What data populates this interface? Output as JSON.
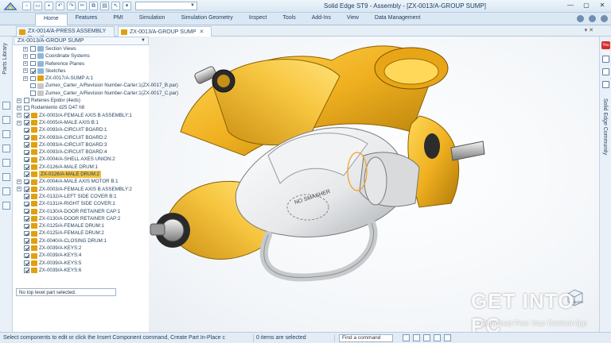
{
  "window": {
    "title": "Solid Edge ST9 - Assembly - [ZX-0013/A-GROUP SUMP]"
  },
  "ribbon": {
    "tabs": [
      "Home",
      "Features",
      "PMI",
      "Simulation",
      "Simulation Geometry",
      "Inspect",
      "Tools",
      "Add-Ins",
      "View",
      "Data Management"
    ],
    "active_tab": "Home"
  },
  "doc_tabs": [
    {
      "label": "ZX-0014/A-PRESS ASSEMBLY in...",
      "active": false
    },
    {
      "label": "ZX-0013/A-GROUP SUMP",
      "active": true
    }
  ],
  "left_strip": {
    "label": "Parts Library"
  },
  "right_strip": {
    "label": "Solid Edge Community",
    "youtube": "You Tube"
  },
  "tree": {
    "header": "ZX-0013/A-GROUP SUMP",
    "rows": [
      {
        "label": "Section Views",
        "indent": 1,
        "exp": "+",
        "checked": false,
        "icon": "#8fb6d8"
      },
      {
        "label": "Coordinate Systems",
        "indent": 1,
        "exp": "+",
        "checked": false,
        "icon": "#8fb6d8"
      },
      {
        "label": "Reference Planes",
        "indent": 1,
        "exp": "+",
        "checked": false,
        "icon": "#8fb6d8"
      },
      {
        "label": "Sketches",
        "indent": 1,
        "exp": "+",
        "checked": true,
        "icon": "#8fb6d8"
      },
      {
        "label": "ZX-0017/A-SUMP A:1",
        "indent": 1,
        "exp": "+",
        "checked": false,
        "icon": "#e0a010"
      },
      {
        "label": "Zumex_Carter_A/Revision Number-Carter:1(ZX-0017_B.par)",
        "indent": 1,
        "exp": "",
        "checked": false,
        "icon": "#c8c8c8"
      },
      {
        "label": "Zumex_Carter_A/Revision Number-Carter:1(ZX-0017_C.par)",
        "indent": 1,
        "exp": "",
        "checked": false,
        "icon": "#c8c8c8"
      },
      {
        "label": "Retenes Epidor (4eds)",
        "indent": 0,
        "exp": "+",
        "checked": false,
        "icon": ""
      },
      {
        "label": "Rodamiento d25 D47 h8",
        "indent": 0,
        "exp": "+",
        "checked": false,
        "icon": ""
      },
      {
        "label": "ZX-0003/A-FEMALE AXIS B ASSEMBLY:1",
        "indent": 0,
        "exp": "+",
        "checked": true,
        "icon": "#e0a010"
      },
      {
        "label": "ZX-0005/A-MALE AXIS B:1",
        "indent": 0,
        "exp": "+",
        "checked": true,
        "icon": "#e0a010"
      },
      {
        "label": "ZX-0093/A-CIRCUIT BOARD:1",
        "indent": 0,
        "exp": "",
        "checked": true,
        "icon": "#e0a010"
      },
      {
        "label": "ZX-0093/A-CIRCUIT BOARD:2",
        "indent": 0,
        "exp": "",
        "checked": true,
        "icon": "#e0a010"
      },
      {
        "label": "ZX-0093/A-CIRCUIT BOARD:3",
        "indent": 0,
        "exp": "",
        "checked": true,
        "icon": "#e0a010"
      },
      {
        "label": "ZX-0093/A-CIRCUIT BOARD:4",
        "indent": 0,
        "exp": "",
        "checked": true,
        "icon": "#e0a010"
      },
      {
        "label": "ZX-0004/A-SHELL AXES UNION:2",
        "indent": 0,
        "exp": "",
        "checked": true,
        "icon": "#e0a010"
      },
      {
        "label": "ZX-0126/A-MALE DRUM:1",
        "indent": 0,
        "exp": "",
        "checked": true,
        "icon": "#e0a010"
      },
      {
        "label": "ZX-0126/A-MALE DRUM:2",
        "indent": 0,
        "exp": "",
        "checked": true,
        "icon": "#e0a010",
        "selected": true
      },
      {
        "label": "ZX-0004/A-MALE AXIS MOTOR B:1",
        "indent": 0,
        "exp": "+",
        "checked": true,
        "icon": "#e0a010"
      },
      {
        "label": "ZX-0003/A-FEMALE AXIS B ASSEMBLY:2",
        "indent": 0,
        "exp": "+",
        "checked": true,
        "icon": "#e0a010"
      },
      {
        "label": "ZX-0132/A-LEFT SIDE COVER B:1",
        "indent": 0,
        "exp": "",
        "checked": true,
        "icon": "#e0a010"
      },
      {
        "label": "ZX-0131/A-RIGHT SIDE COVER:1",
        "indent": 0,
        "exp": "",
        "checked": true,
        "icon": "#e0a010"
      },
      {
        "label": "ZX-0130/A-DOOR RETAINER CAP:1",
        "indent": 0,
        "exp": "",
        "checked": true,
        "icon": "#e0a010"
      },
      {
        "label": "ZX-0130/A-DOOR RETAINER CAP:2",
        "indent": 0,
        "exp": "",
        "checked": true,
        "icon": "#e0a010"
      },
      {
        "label": "ZX-0125/A-FEMALE DRUM:1",
        "indent": 0,
        "exp": "",
        "checked": true,
        "icon": "#e0a010"
      },
      {
        "label": "ZX-0125/A-FEMALE DRUM:2",
        "indent": 0,
        "exp": "",
        "checked": true,
        "icon": "#e0a010"
      },
      {
        "label": "ZX-0040/A-CLOSING DRUM:1",
        "indent": 0,
        "exp": "",
        "checked": true,
        "icon": "#e0a010"
      },
      {
        "label": "ZX-0039/A-KEYS:2",
        "indent": 0,
        "exp": "",
        "checked": true,
        "icon": "#e0a010"
      },
      {
        "label": "ZX-0039/A-KEYS:4",
        "indent": 0,
        "exp": "",
        "checked": true,
        "icon": "#e0a010"
      },
      {
        "label": "ZX-0039/A-KEYS:5",
        "indent": 0,
        "exp": "",
        "checked": true,
        "icon": "#e0a010"
      },
      {
        "label": "ZX-0039/A-KEYS:6",
        "indent": 0,
        "exp": "",
        "checked": true,
        "icon": "#e0a010"
      }
    ],
    "status": "No top level part selected."
  },
  "viewport": {
    "housing_label": "NO SMASHER"
  },
  "statusbar": {
    "message": "Select components to edit or click the Insert Component command, Create Part In-Place c",
    "selection": "0 items are selected",
    "find_placeholder": "Find a command"
  },
  "navcube": {
    "label": "BACK"
  },
  "watermark": {
    "logo": "GET INTO PC",
    "sub": "Download Free Your Desired App"
  },
  "colors": {
    "accent": "#2a5d8f",
    "part_yellow": "#f0b020",
    "selection": "#f0c040"
  }
}
